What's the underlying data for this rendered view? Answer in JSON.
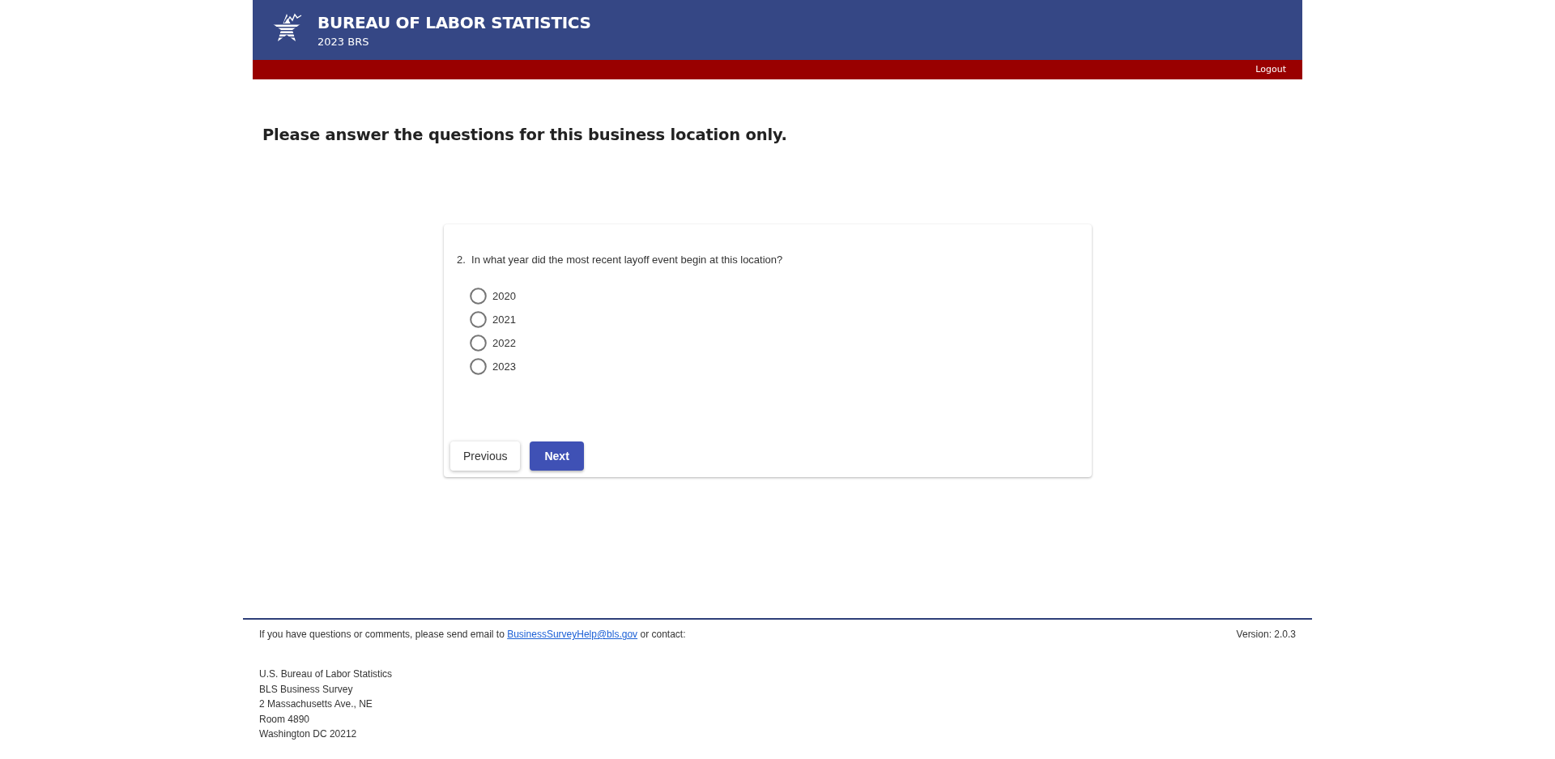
{
  "header": {
    "title": "BUREAU OF LABOR STATISTICS",
    "subtitle": "2023 BRS",
    "logout": "Logout"
  },
  "heading": "Please answer the questions for this business location only.",
  "question": {
    "number": "2.",
    "text": "In what year did the most recent layoff event begin at this location?",
    "options": [
      {
        "label": "2020",
        "selected": false
      },
      {
        "label": "2021",
        "selected": false
      },
      {
        "label": "2022",
        "selected": false
      },
      {
        "label": "2023",
        "selected": false
      }
    ]
  },
  "buttons": [
    {
      "label": "Previous",
      "kind": "secondary"
    },
    {
      "label": "Next",
      "kind": "primary"
    }
  ],
  "footer": {
    "contact_before": "If you have questions or comments, please send email to",
    "email": "BusinessSurveyHelp@bls.gov",
    "contact_after": "or contact:",
    "version": "Version: 2.0.3",
    "address": [
      "U.S. Bureau of Labor Statistics",
      "BLS Business Survey",
      "2 Massachusetts Ave., NE",
      "Room 4890",
      "Washington DC 20212"
    ]
  }
}
